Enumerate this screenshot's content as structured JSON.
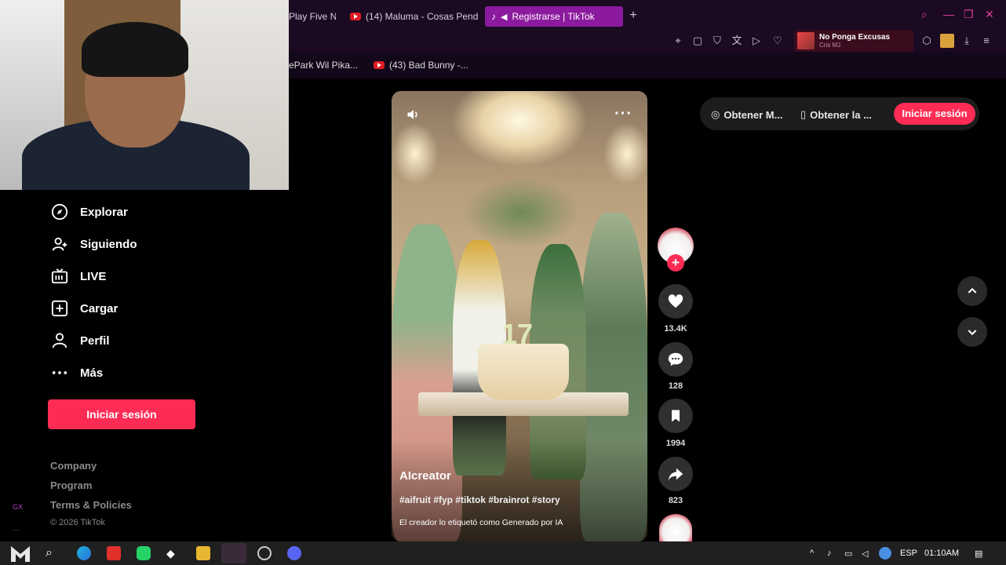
{
  "browser": {
    "tabs": [
      {
        "label": "Play Five N",
        "active": false,
        "icon": "none"
      },
      {
        "label": "(14) Maluma - Cosas Pend",
        "active": false,
        "icon": "youtube-icon"
      },
      {
        "label": "Registrarse | TikTok",
        "active": true,
        "icon": "tiktok-icon"
      }
    ],
    "new_tab": "+",
    "media": {
      "title": "No Ponga Excusas",
      "artist": "Cris MJ"
    },
    "bookmarks": [
      {
        "label": "ePark Wil Pika..."
      },
      {
        "label": "(43) Bad Bunny -..."
      }
    ]
  },
  "sidebar": {
    "items": [
      {
        "label": "Explorar",
        "icon": "compass-icon"
      },
      {
        "label": "Siguiendo",
        "icon": "user-follow-icon"
      },
      {
        "label": "LIVE",
        "icon": "live-tv-icon"
      },
      {
        "label": "Cargar",
        "icon": "upload-plus-icon"
      },
      {
        "label": "Perfil",
        "icon": "person-icon"
      },
      {
        "label": "Más",
        "icon": "more-dots-icon"
      }
    ],
    "login_label": "Iniciar sesión",
    "footer": {
      "company": "Company",
      "program": "Program",
      "terms": "Terms & Policies",
      "copyright": "© 2026 TikTok"
    }
  },
  "video": {
    "author": "AIcreator",
    "hashtags": "#aifruit #fyp #tiktok #brainrot #story",
    "ai_label": "El creador lo etiquetó como Generado por IA",
    "candle_number": "17",
    "more": "···"
  },
  "actions": {
    "likes": "13.4K",
    "comments": "128",
    "saves": "1994",
    "shares": "823",
    "follow": "+"
  },
  "topbar": {
    "get_app_1": "Obtener M...",
    "get_app_2": "Obtener la ...",
    "login": "Iniciar sesión"
  },
  "edge_marks": [
    "GX",
    "···"
  ],
  "taskbar": {
    "language": "ESP",
    "time": "01:10AM"
  },
  "colors": {
    "accent": "#fe2c55",
    "browser_accent": "#8c1a9e",
    "background": "#000000"
  }
}
